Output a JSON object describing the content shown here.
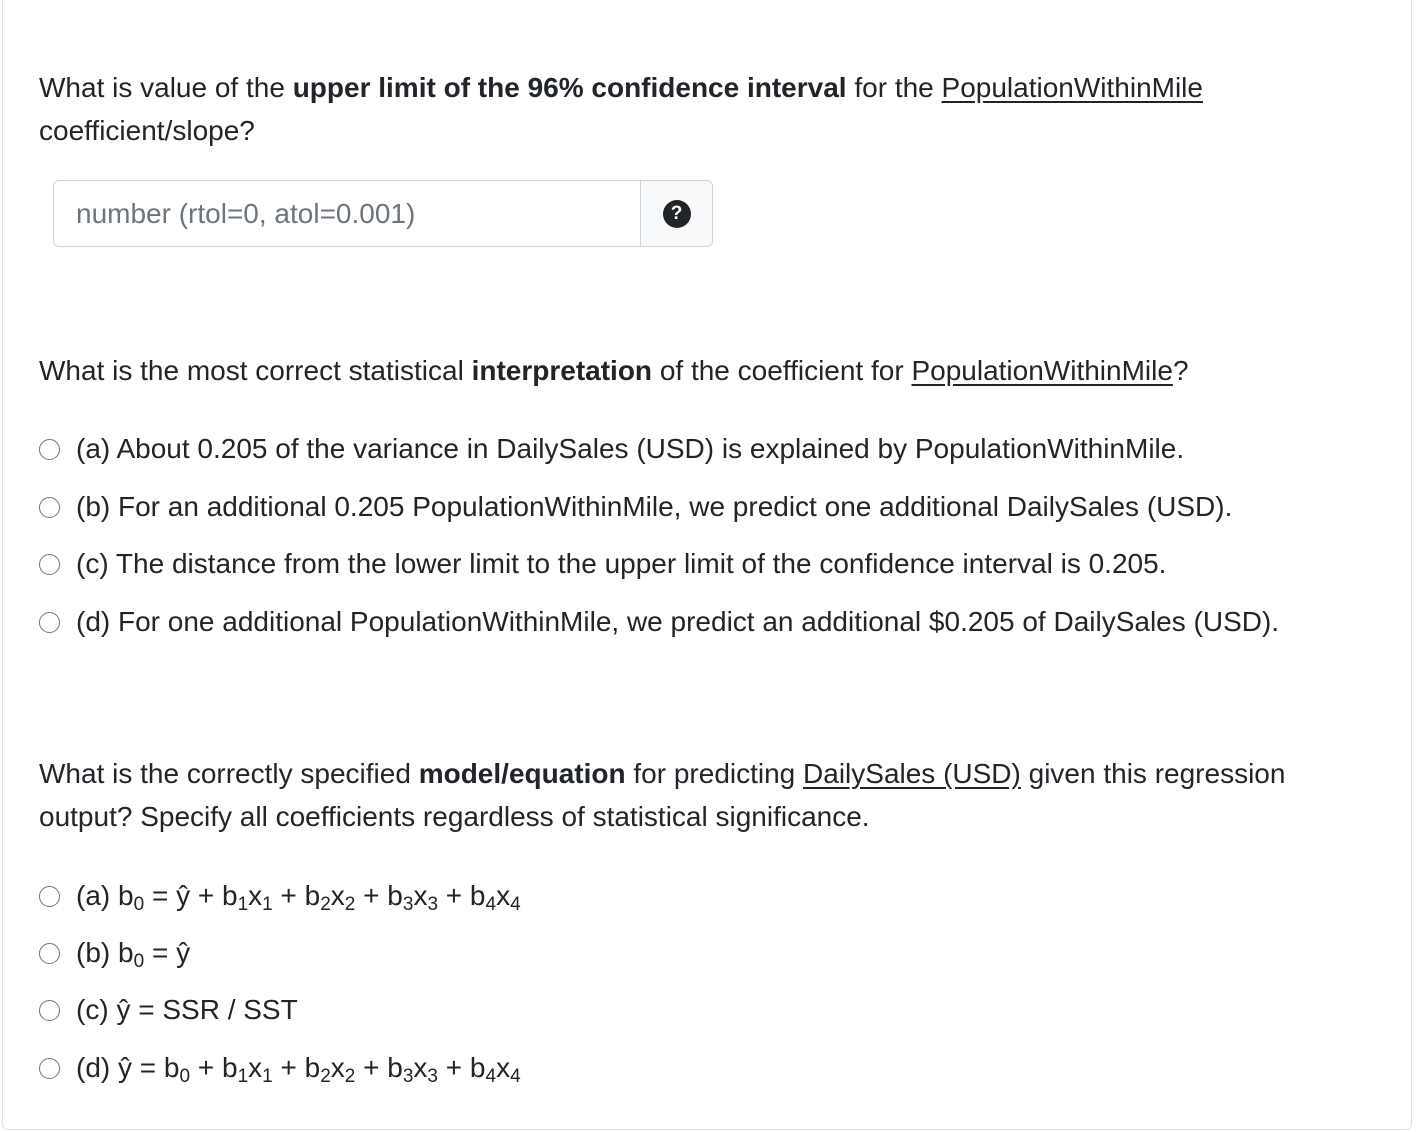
{
  "question1": {
    "prefix": "What is value of the ",
    "bold": "upper limit of the 96% confidence interval",
    "middle": " for the ",
    "underlined": "PopulationWithinMile",
    "line2": "coefficient/slope?",
    "input_placeholder": "number (rtol=0, atol=0.001)",
    "help_symbol": "?"
  },
  "question2": {
    "prefix": "What is the most correct statistical ",
    "bold": "interpretation",
    "middle": " of the coefficient for ",
    "underlined": "PopulationWithinMile",
    "suffix": "?",
    "options": [
      "(a) About 0.205 of the variance in DailySales (USD) is explained by PopulationWithinMile.",
      "(b) For an additional 0.205 PopulationWithinMile, we predict one additional DailySales (USD).",
      "(c) The distance from the lower limit to the upper limit of the confidence interval is 0.205.",
      "(d) For one additional PopulationWithinMile, we predict an additional $0.205 of DailySales (USD)."
    ]
  },
  "question3": {
    "prefix": "What is the correctly specified ",
    "bold": "model/equation",
    "middle": " for predicting ",
    "underlined": "DailySales (USD)",
    "suffix": " given this regression",
    "line2": "output? Specify all coefficients regardless of statistical significance.",
    "options": [
      {
        "letter": "(a)",
        "lhs": "b",
        "lhs_sub": "0",
        "eq": " = ŷ + b",
        "t1_sub": "1",
        "x1": "x",
        "x1_sub": "1",
        "p2": " + b",
        "t2_sub": "2",
        "x2": "x",
        "x2_sub": "2",
        "p3": " + b",
        "t3_sub": "3",
        "x3": "x",
        "x3_sub": "3",
        "p4": " + b",
        "t4_sub": "4",
        "x4": "x",
        "x4_sub": "4"
      },
      {
        "letter": "(b)",
        "text": "b",
        "sub": "0",
        "rest": " = ŷ"
      },
      {
        "letter": "(c)",
        "text": "ŷ = SSR / SST"
      },
      {
        "letter": "(d)",
        "lhs": "ŷ = b",
        "lhs_sub": "0",
        "eq": " + b",
        "t1_sub": "1",
        "x1": "x",
        "x1_sub": "1",
        "p2": " + b",
        "t2_sub": "2",
        "x2": "x",
        "x2_sub": "2",
        "p3": " + b",
        "t3_sub": "3",
        "x3": "x",
        "x3_sub": "3",
        "p4": " + b",
        "t4_sub": "4",
        "x4": "x",
        "x4_sub": "4"
      }
    ]
  }
}
